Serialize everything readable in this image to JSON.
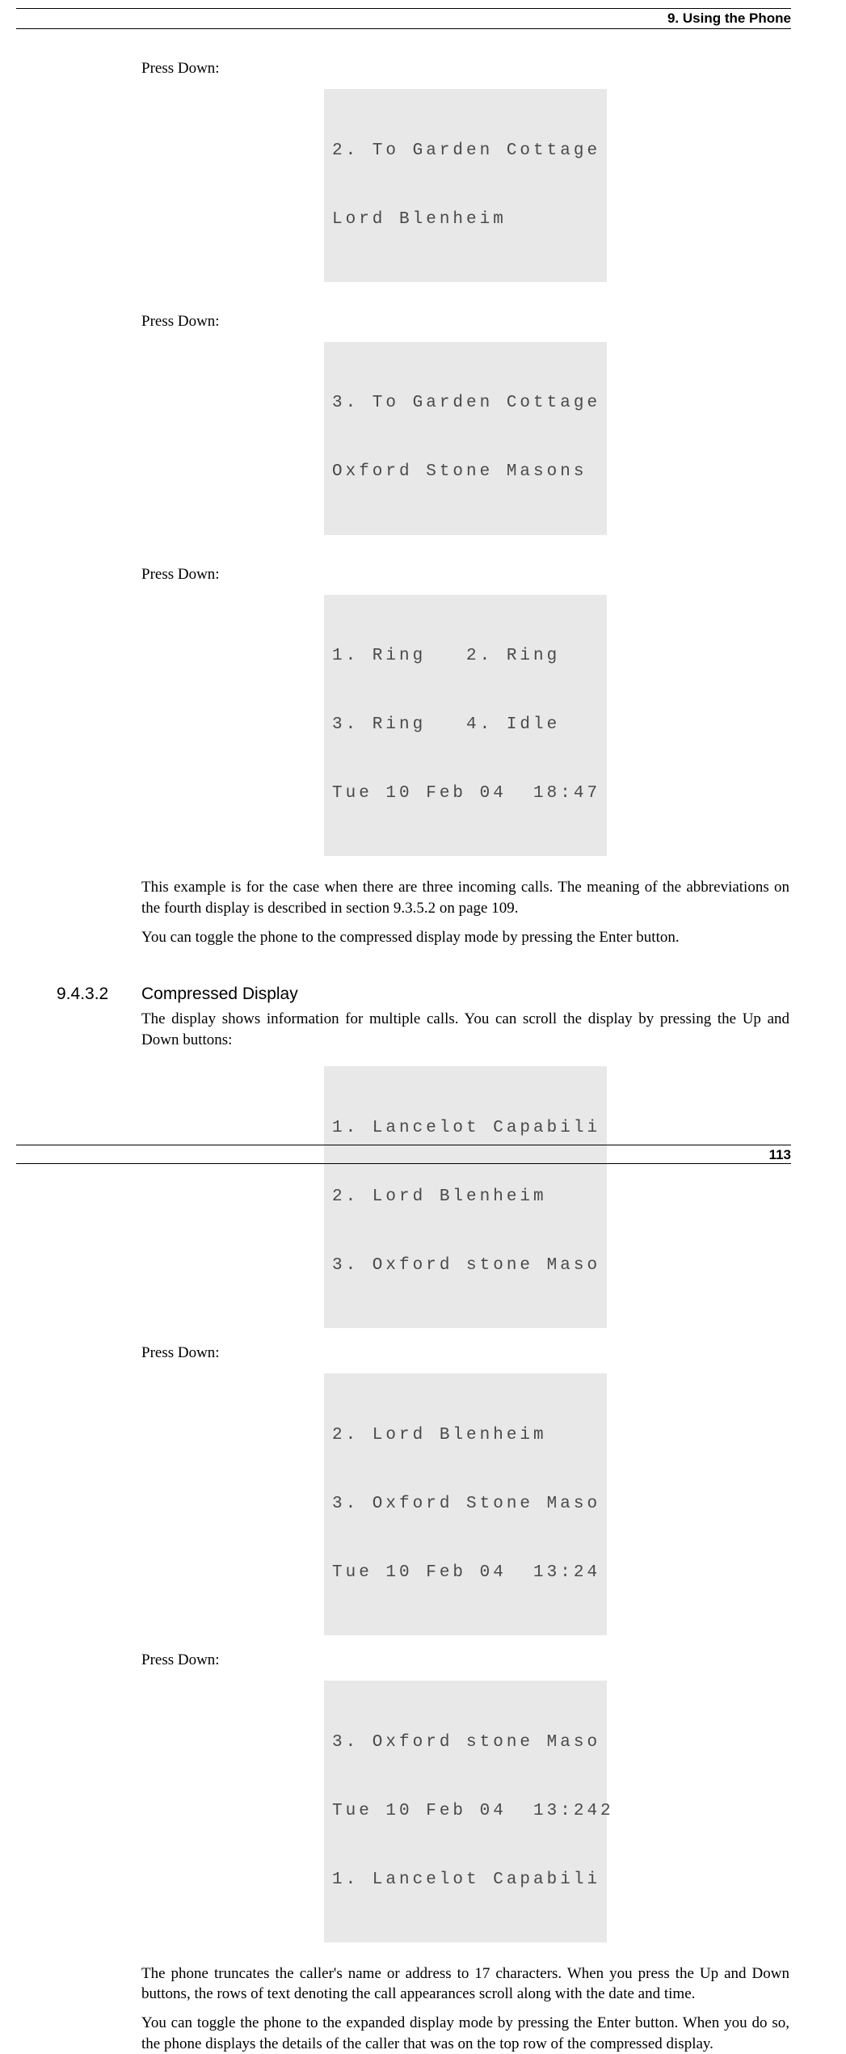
{
  "header": {
    "chapter": "9. Using the Phone"
  },
  "footer": {
    "page": "113"
  },
  "press_label": "Press Down:",
  "lcd1": {
    "line1": "2. To Garden Cottage",
    "line2": "Lord Blenheim"
  },
  "lcd2": {
    "line1": "3. To Garden Cottage",
    "line2": "Oxford Stone Masons"
  },
  "lcd3": {
    "line1": "1. Ring   2. Ring",
    "line2": "3. Ring   4. Idle",
    "line3": "Tue 10 Feb 04  18:47"
  },
  "para1": "This example is for the case when there are three incoming calls. The meaning of the abbreviations on the fourth display is described in section 9.3.5.2 on page 109.",
  "para2": "You can toggle the phone to the compressed display mode by pressing the Enter button.",
  "section": {
    "number": "9.4.3.2",
    "title": "Compressed Display"
  },
  "para3": "The display shows information for multiple calls. You can scroll the display by pressing the Up and Down buttons:",
  "lcd4": {
    "line1": "1. Lancelot Capabili",
    "line2": "2. Lord Blenheim",
    "line3": "3. Oxford stone Maso"
  },
  "lcd5": {
    "line1": "2. Lord Blenheim",
    "line2": "3. Oxford Stone Maso",
    "line3": "Tue 10 Feb 04  13:24"
  },
  "lcd6": {
    "line1": "3. Oxford stone Maso",
    "line2": "Tue 10 Feb 04  13:242",
    "line3": "1. Lancelot Capabili"
  },
  "para4": "The phone truncates the caller's name or address to 17 characters. When you press the Up and Down buttons, the rows of text denoting the call appearances scroll along with the date and time.",
  "para5": "You can toggle the phone to the expanded display mode by pressing the Enter button. When you do so, the phone displays the details of the caller that was on the top row of the compressed display."
}
